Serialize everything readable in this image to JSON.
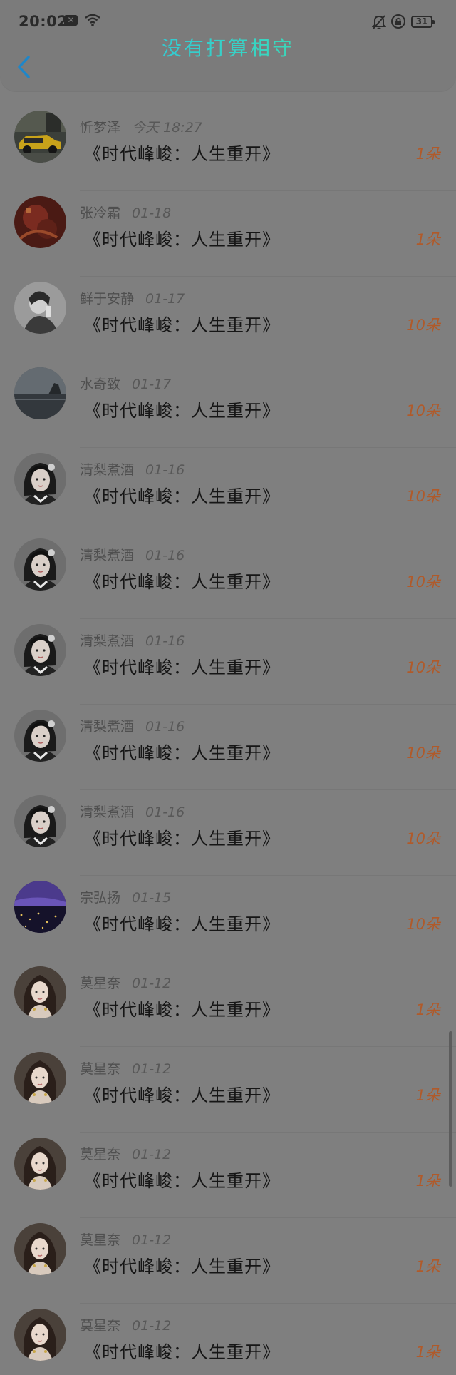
{
  "status_bar": {
    "time": "20:02",
    "battery": "31"
  },
  "header": {
    "title": "没有打算相守"
  },
  "rows": [
    {
      "name": "忻梦泽",
      "date": "今天 18:27",
      "book": "《时代峰峻：人生重开》",
      "count": "1朵",
      "avatar": "car"
    },
    {
      "name": "张冷霜",
      "date": "01-18",
      "book": "《时代峰峻：人生重开》",
      "count": "1朵",
      "avatar": "red"
    },
    {
      "name": "鲜于安静",
      "date": "01-17",
      "book": "《时代峰峻：人生重开》",
      "count": "10朵",
      "avatar": "bw-portrait"
    },
    {
      "name": "水奇致",
      "date": "01-17",
      "book": "《时代峰峻：人生重开》",
      "count": "10朵",
      "avatar": "sea"
    },
    {
      "name": "清梨煮酒",
      "date": "01-16",
      "book": "《时代峰峻：人生重开》",
      "count": "10朵",
      "avatar": "girl"
    },
    {
      "name": "清梨煮酒",
      "date": "01-16",
      "book": "《时代峰峻：人生重开》",
      "count": "10朵",
      "avatar": "girl"
    },
    {
      "name": "清梨煮酒",
      "date": "01-16",
      "book": "《时代峰峻：人生重开》",
      "count": "10朵",
      "avatar": "girl"
    },
    {
      "name": "清梨煮酒",
      "date": "01-16",
      "book": "《时代峰峻：人生重开》",
      "count": "10朵",
      "avatar": "girl"
    },
    {
      "name": "清梨煮酒",
      "date": "01-16",
      "book": "《时代峰峻：人生重开》",
      "count": "10朵",
      "avatar": "girl"
    },
    {
      "name": "宗弘扬",
      "date": "01-15",
      "book": "《时代峰峻：人生重开》",
      "count": "10朵",
      "avatar": "night"
    },
    {
      "name": "莫星奈",
      "date": "01-12",
      "book": "《时代峰峻：人生重开》",
      "count": "1朵",
      "avatar": "doll"
    },
    {
      "name": "莫星奈",
      "date": "01-12",
      "book": "《时代峰峻：人生重开》",
      "count": "1朵",
      "avatar": "doll"
    },
    {
      "name": "莫星奈",
      "date": "01-12",
      "book": "《时代峰峻：人生重开》",
      "count": "1朵",
      "avatar": "doll"
    },
    {
      "name": "莫星奈",
      "date": "01-12",
      "book": "《时代峰峻：人生重开》",
      "count": "1朵",
      "avatar": "doll"
    },
    {
      "name": "莫星奈",
      "date": "01-12",
      "book": "《时代峰峻：人生重开》",
      "count": "1朵",
      "avatar": "doll"
    }
  ],
  "colors": {
    "title_gradient_start": "#2fb6e6",
    "title_gradient_end": "#46e28b",
    "back_arrow": "#1f86c8",
    "count_text": "#b05a2a"
  }
}
